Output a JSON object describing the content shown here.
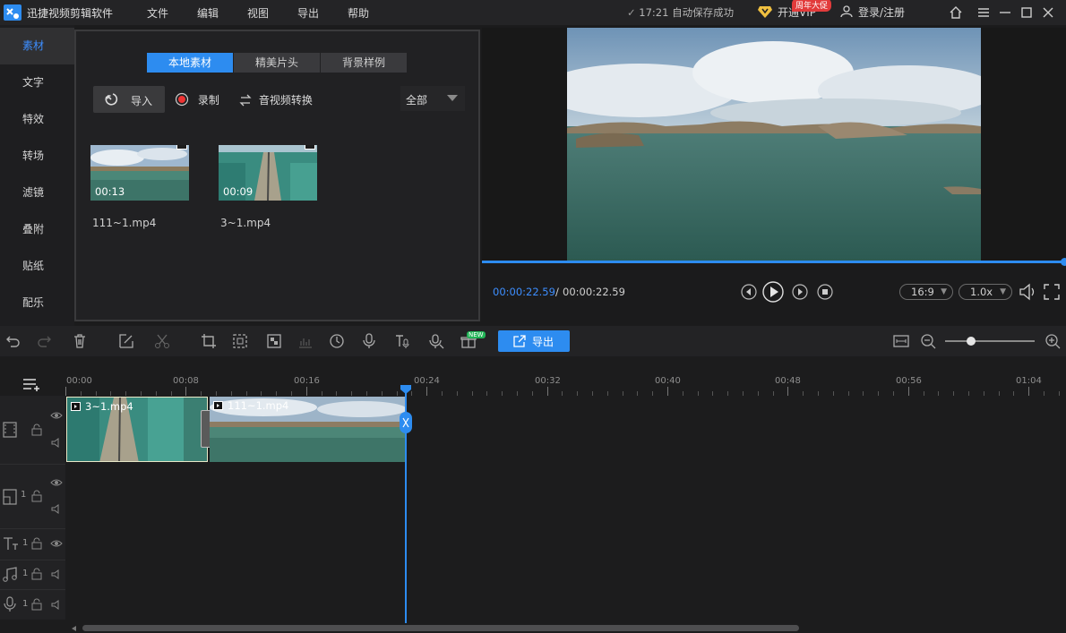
{
  "app": {
    "name": "迅捷视频剪辑软件"
  },
  "menu": [
    "文件",
    "编辑",
    "视图",
    "导出",
    "帮助"
  ],
  "header": {
    "autosave": "17:21 自动保存成功",
    "vip": "开通VIP",
    "vip_badge": "周年大促",
    "login": "登录/注册"
  },
  "sidebar": {
    "items": [
      {
        "label": "素材"
      },
      {
        "label": "文字"
      },
      {
        "label": "特效"
      },
      {
        "label": "转场"
      },
      {
        "label": "滤镜"
      },
      {
        "label": "叠附"
      },
      {
        "label": "贴纸"
      },
      {
        "label": "配乐"
      }
    ]
  },
  "media": {
    "tabs": [
      {
        "label": "本地素材"
      },
      {
        "label": "精美片头"
      },
      {
        "label": "背景样例"
      }
    ],
    "import_label": "导入",
    "record_label": "录制",
    "convert_label": "音视频转换",
    "filter_value": "全部",
    "items": [
      {
        "name": "111~1.mp4",
        "duration": "00:13"
      },
      {
        "name": "3~1.mp4",
        "duration": "00:09"
      }
    ]
  },
  "preview": {
    "current_time": "00:00:22.59",
    "separator": "/",
    "total_time": "00:00:22.59",
    "aspect": "16:9",
    "speed": "1.0x",
    "progress": 1.0
  },
  "toolbar": {
    "export_label": "导出",
    "new_badge": "NEW",
    "zoom": 0.3
  },
  "timeline": {
    "ruler": [
      "00:00",
      "00:08",
      "00:16",
      "00:24",
      "00:32",
      "00:40",
      "00:48",
      "00:56",
      "01:04"
    ],
    "clips": [
      {
        "name": "3~1.mp4"
      },
      {
        "name": "111~1.mp4"
      }
    ],
    "track_lock_count": "1"
  },
  "colors": {
    "accent": "#2d8cf0",
    "bg": "#1b1b1c",
    "vip_gold": "#f0c040",
    "badge_red": "#e23b3b"
  }
}
